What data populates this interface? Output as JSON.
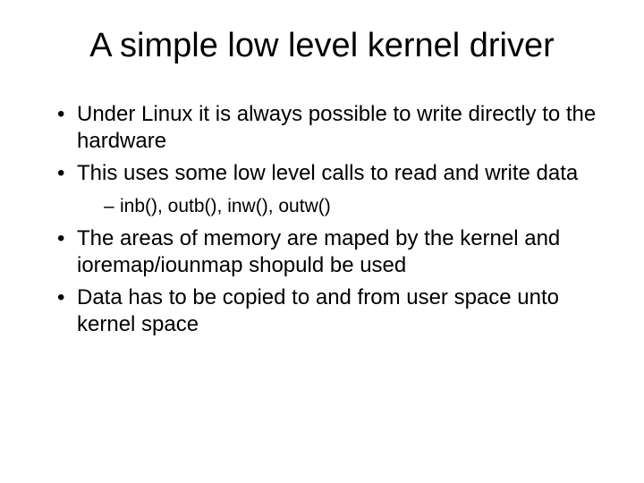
{
  "title": "A simple low level kernel driver",
  "bullets": [
    {
      "text": "Under Linux it is always possible to write directly to the hardware",
      "sub": []
    },
    {
      "text": "This uses some low level calls to read and write data",
      "sub": [
        "inb(), outb(), inw(), outw()"
      ]
    },
    {
      "text": "The areas of memory are maped by the kernel and ioremap/iounmap shopuld be used",
      "sub": []
    },
    {
      "text": "Data has to be copied to and from user space unto kernel space",
      "sub": []
    }
  ]
}
